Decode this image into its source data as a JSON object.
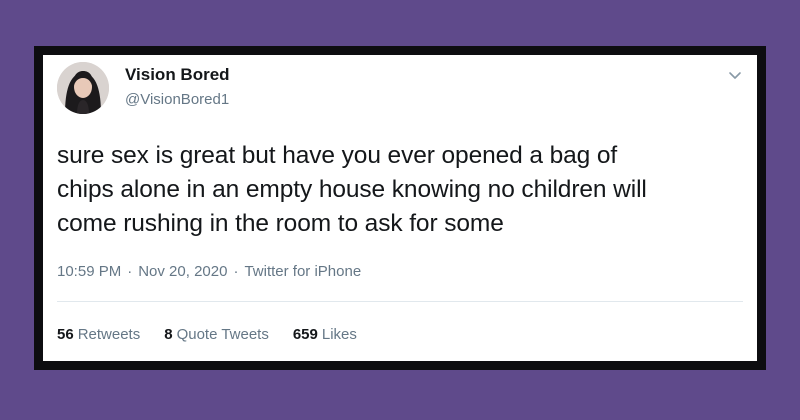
{
  "tweet": {
    "author_name": "Vision Bored",
    "author_handle": "@VisionBored1",
    "text": "sure sex is great but have you ever opened a bag of\nchips alone in an empty house knowing no children will\ncome rushing in the room to ask for some",
    "time": "10:59 PM",
    "separator": "·",
    "date": "Nov 20, 2020",
    "source": "Twitter for iPhone",
    "stats": {
      "retweets_count": "56",
      "retweets_label": "Retweets",
      "quotes_count": "8",
      "quotes_label": "Quote Tweets",
      "likes_count": "659",
      "likes_label": "Likes"
    }
  },
  "colors": {
    "background": "#5f4a8b",
    "frame": "#0d0d10",
    "card": "#ffffff",
    "text_primary": "#14171a",
    "text_secondary": "#657786"
  },
  "icons": {
    "menu": "chevron-down-icon"
  }
}
